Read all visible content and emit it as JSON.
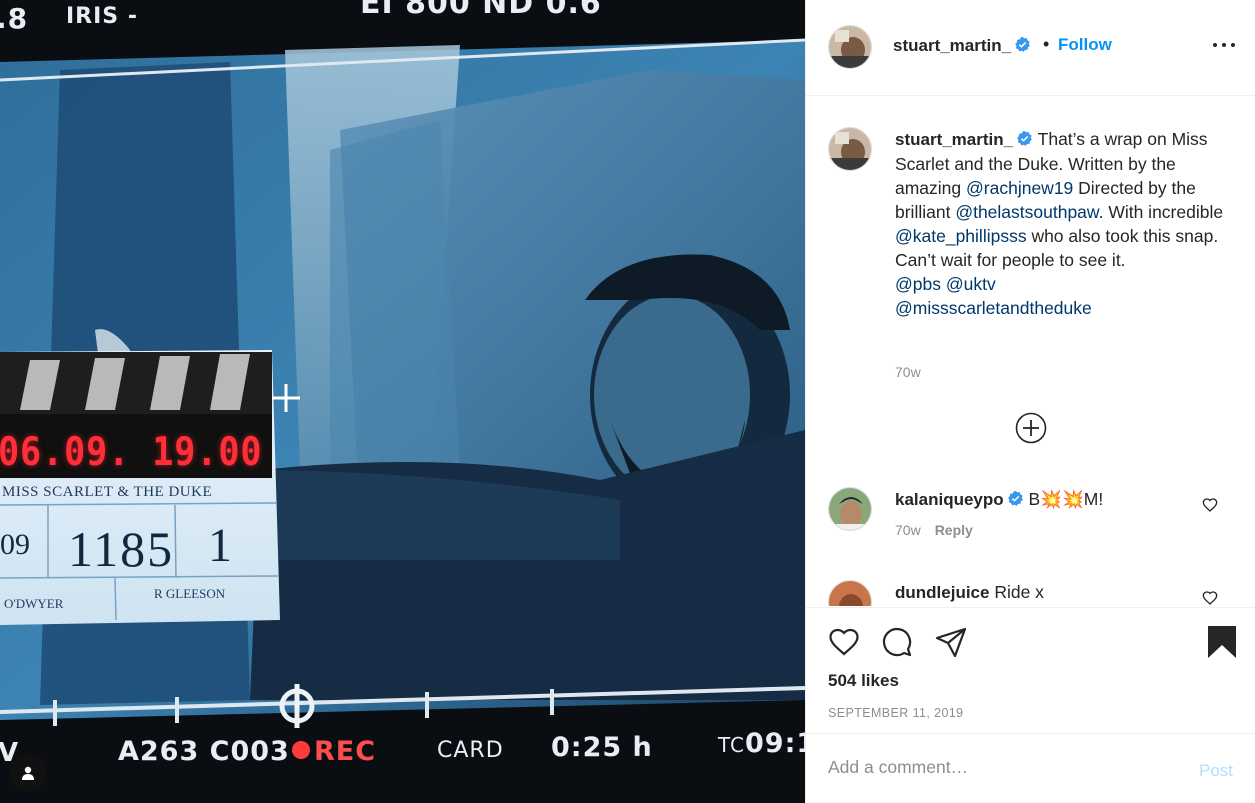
{
  "photo": {
    "hud_top": {
      "aperture": ".8",
      "iris": "IRIS -",
      "ei": "EI 800   ND 0.6"
    },
    "hud_bottom": {
      "v": "V",
      "reel": "A263 C003",
      "rec": "REC",
      "card": "CARD",
      "remaining": "0:25 h",
      "tc_label": "TC",
      "tc": "09:1"
    },
    "slate": {
      "date": "06.09. 19.00",
      "title": "MISS SCARLET & THE DUKE",
      "roll": "09",
      "scene": "1185",
      "take": "1",
      "director": "O'DWYER",
      "dop": "R GLEESON"
    }
  },
  "header": {
    "username": "stuart_martin_",
    "separator": "•",
    "follow_label": "Follow"
  },
  "caption": {
    "username": "stuart_martin_",
    "text_1": " That’s a wrap on Miss Scarlet and the Duke. Written by the amazing ",
    "mention_1": "@rachjnew19",
    "text_2": " Directed by the brilliant ",
    "mention_2": "@thelastsouthpaw",
    "text_3": ". With incredible ",
    "mention_3": "@kate_phillipsss",
    "text_4": " who also took this snap. Can’t wait for people to see it.",
    "mention_4": "@pbs",
    "mention_5": "@uktv",
    "mention_6": "@missscarletandtheduke",
    "time": "70w"
  },
  "comments": [
    {
      "username": "kalaniqueypo",
      "text": " B💥💥M!",
      "time": "70w",
      "reply_label": "Reply"
    },
    {
      "username": "dundlejuice",
      "text": " Ride x"
    }
  ],
  "actions": {
    "likes": "504 likes",
    "date": "SEPTEMBER 11, 2019"
  },
  "add_comment": {
    "placeholder": "Add a comment…",
    "post_label": "Post"
  },
  "colors": {
    "link": "#0095f6",
    "mention": "#00376b",
    "post_disabled": "#b2dffc",
    "muted": "#8e8e8e"
  }
}
